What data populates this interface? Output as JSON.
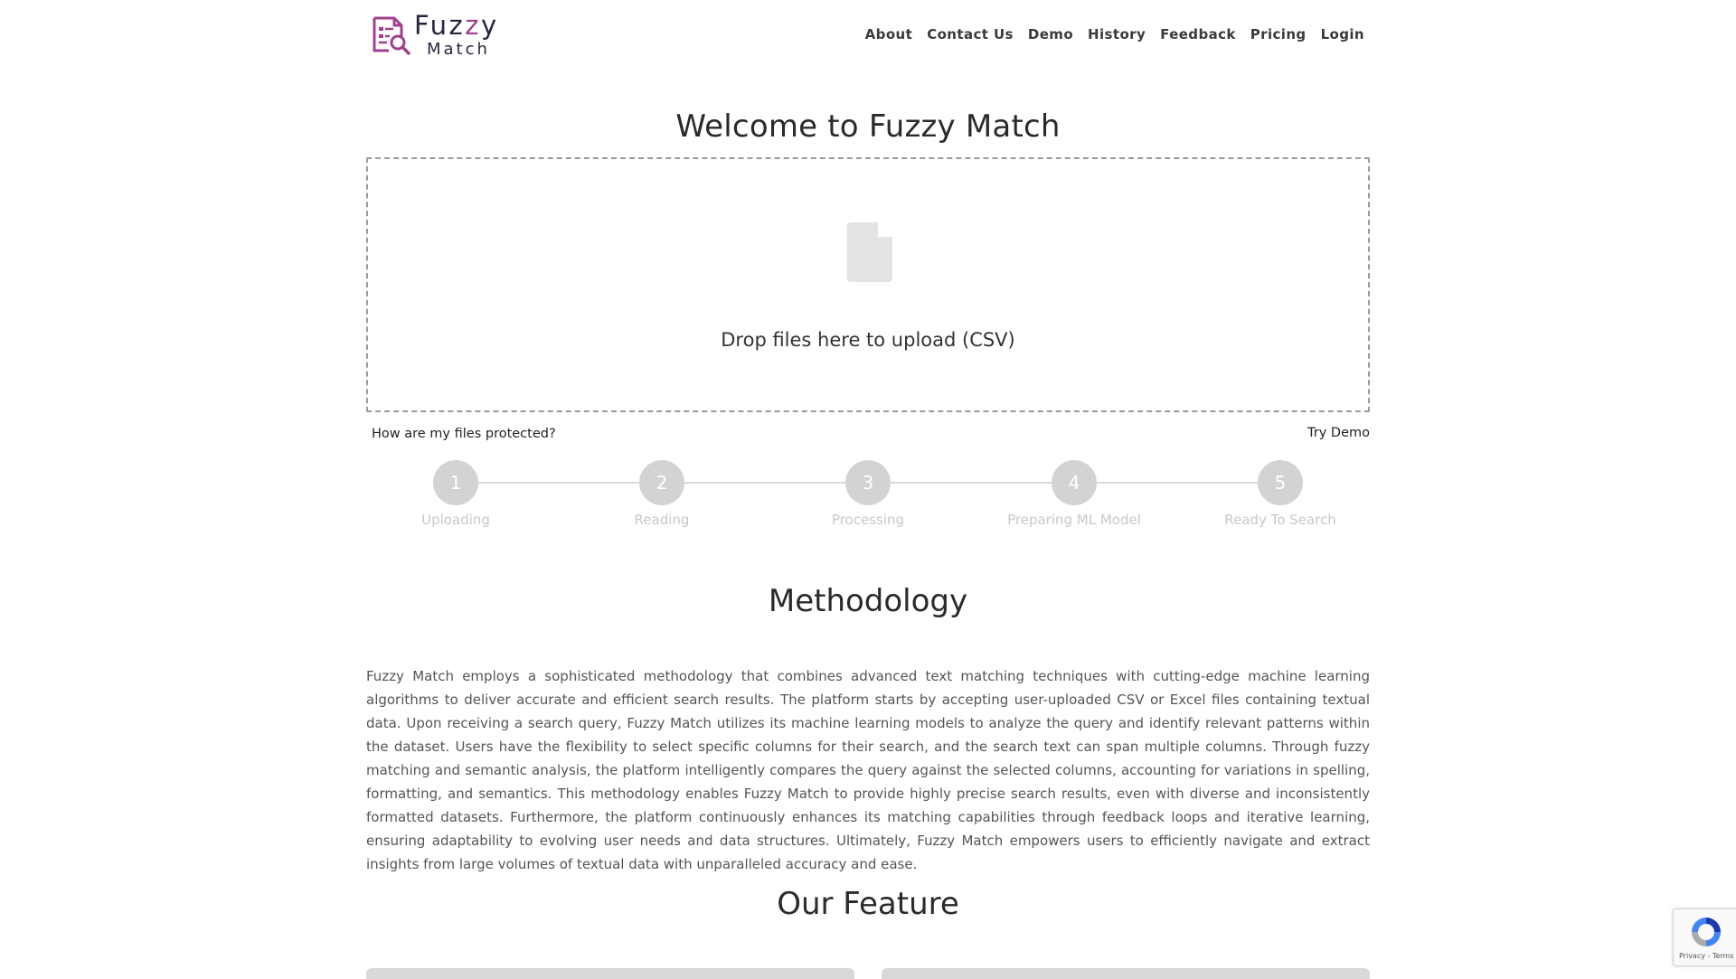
{
  "logo": {
    "line1_a": "Fuz",
    "line1_b": "z",
    "line1_c": "y",
    "line2": "Match"
  },
  "nav": {
    "items": [
      {
        "label": "About"
      },
      {
        "label": "Contact Us"
      },
      {
        "label": "Demo"
      },
      {
        "label": "History"
      },
      {
        "label": "Feedback"
      },
      {
        "label": "Pricing"
      },
      {
        "label": "Login"
      }
    ]
  },
  "hero": {
    "title": "Welcome to Fuzzy Match",
    "dropzone_text": "Drop files here to upload (CSV)",
    "protect_link": "How are my files protected?",
    "try_demo": "Try Demo"
  },
  "steps": [
    {
      "number": "1",
      "label": "Uploading"
    },
    {
      "number": "2",
      "label": "Reading"
    },
    {
      "number": "3",
      "label": "Processing"
    },
    {
      "number": "4",
      "label": "Preparing ML Model"
    },
    {
      "number": "5",
      "label": "Ready To Search"
    }
  ],
  "methodology": {
    "title": "Methodology",
    "body": "Fuzzy Match employs a sophisticated methodology that combines advanced text matching techniques with cutting-edge machine learning algorithms to deliver accurate and efficient search results. The platform starts by accepting user-uploaded CSV or Excel files containing textual data. Upon receiving a search query, Fuzzy Match utilizes its machine learning models to analyze the query and identify relevant patterns within the dataset. Users have the flexibility to select specific columns for their search, and the search text can span multiple columns. Through fuzzy matching and semantic analysis, the platform intelligently compares the query against the selected columns, accounting for variations in spelling, formatting, and semantics. This methodology enables Fuzzy Match to provide highly precise search results, even with diverse and inconsistently formatted datasets. Furthermore, the platform continuously enhances its matching capabilities through feedback loops and iterative learning, ensuring adaptability to evolving user needs and data structures. Ultimately, Fuzzy Match empowers users to efficiently navigate and extract insights from large volumes of textual data with unparalleled accuracy and ease."
  },
  "features": {
    "title": "Our Feature"
  },
  "recaptcha": {
    "footer": "Privacy - Terms"
  },
  "colors": {
    "logo_dark": "#2c2340",
    "logo_accent": "#a0408c",
    "step_inactive": "#d3d3d3",
    "text_muted": "#555555"
  },
  "icons": [
    "logo-document-search-icon",
    "file-icon",
    "recaptcha-icon"
  ]
}
